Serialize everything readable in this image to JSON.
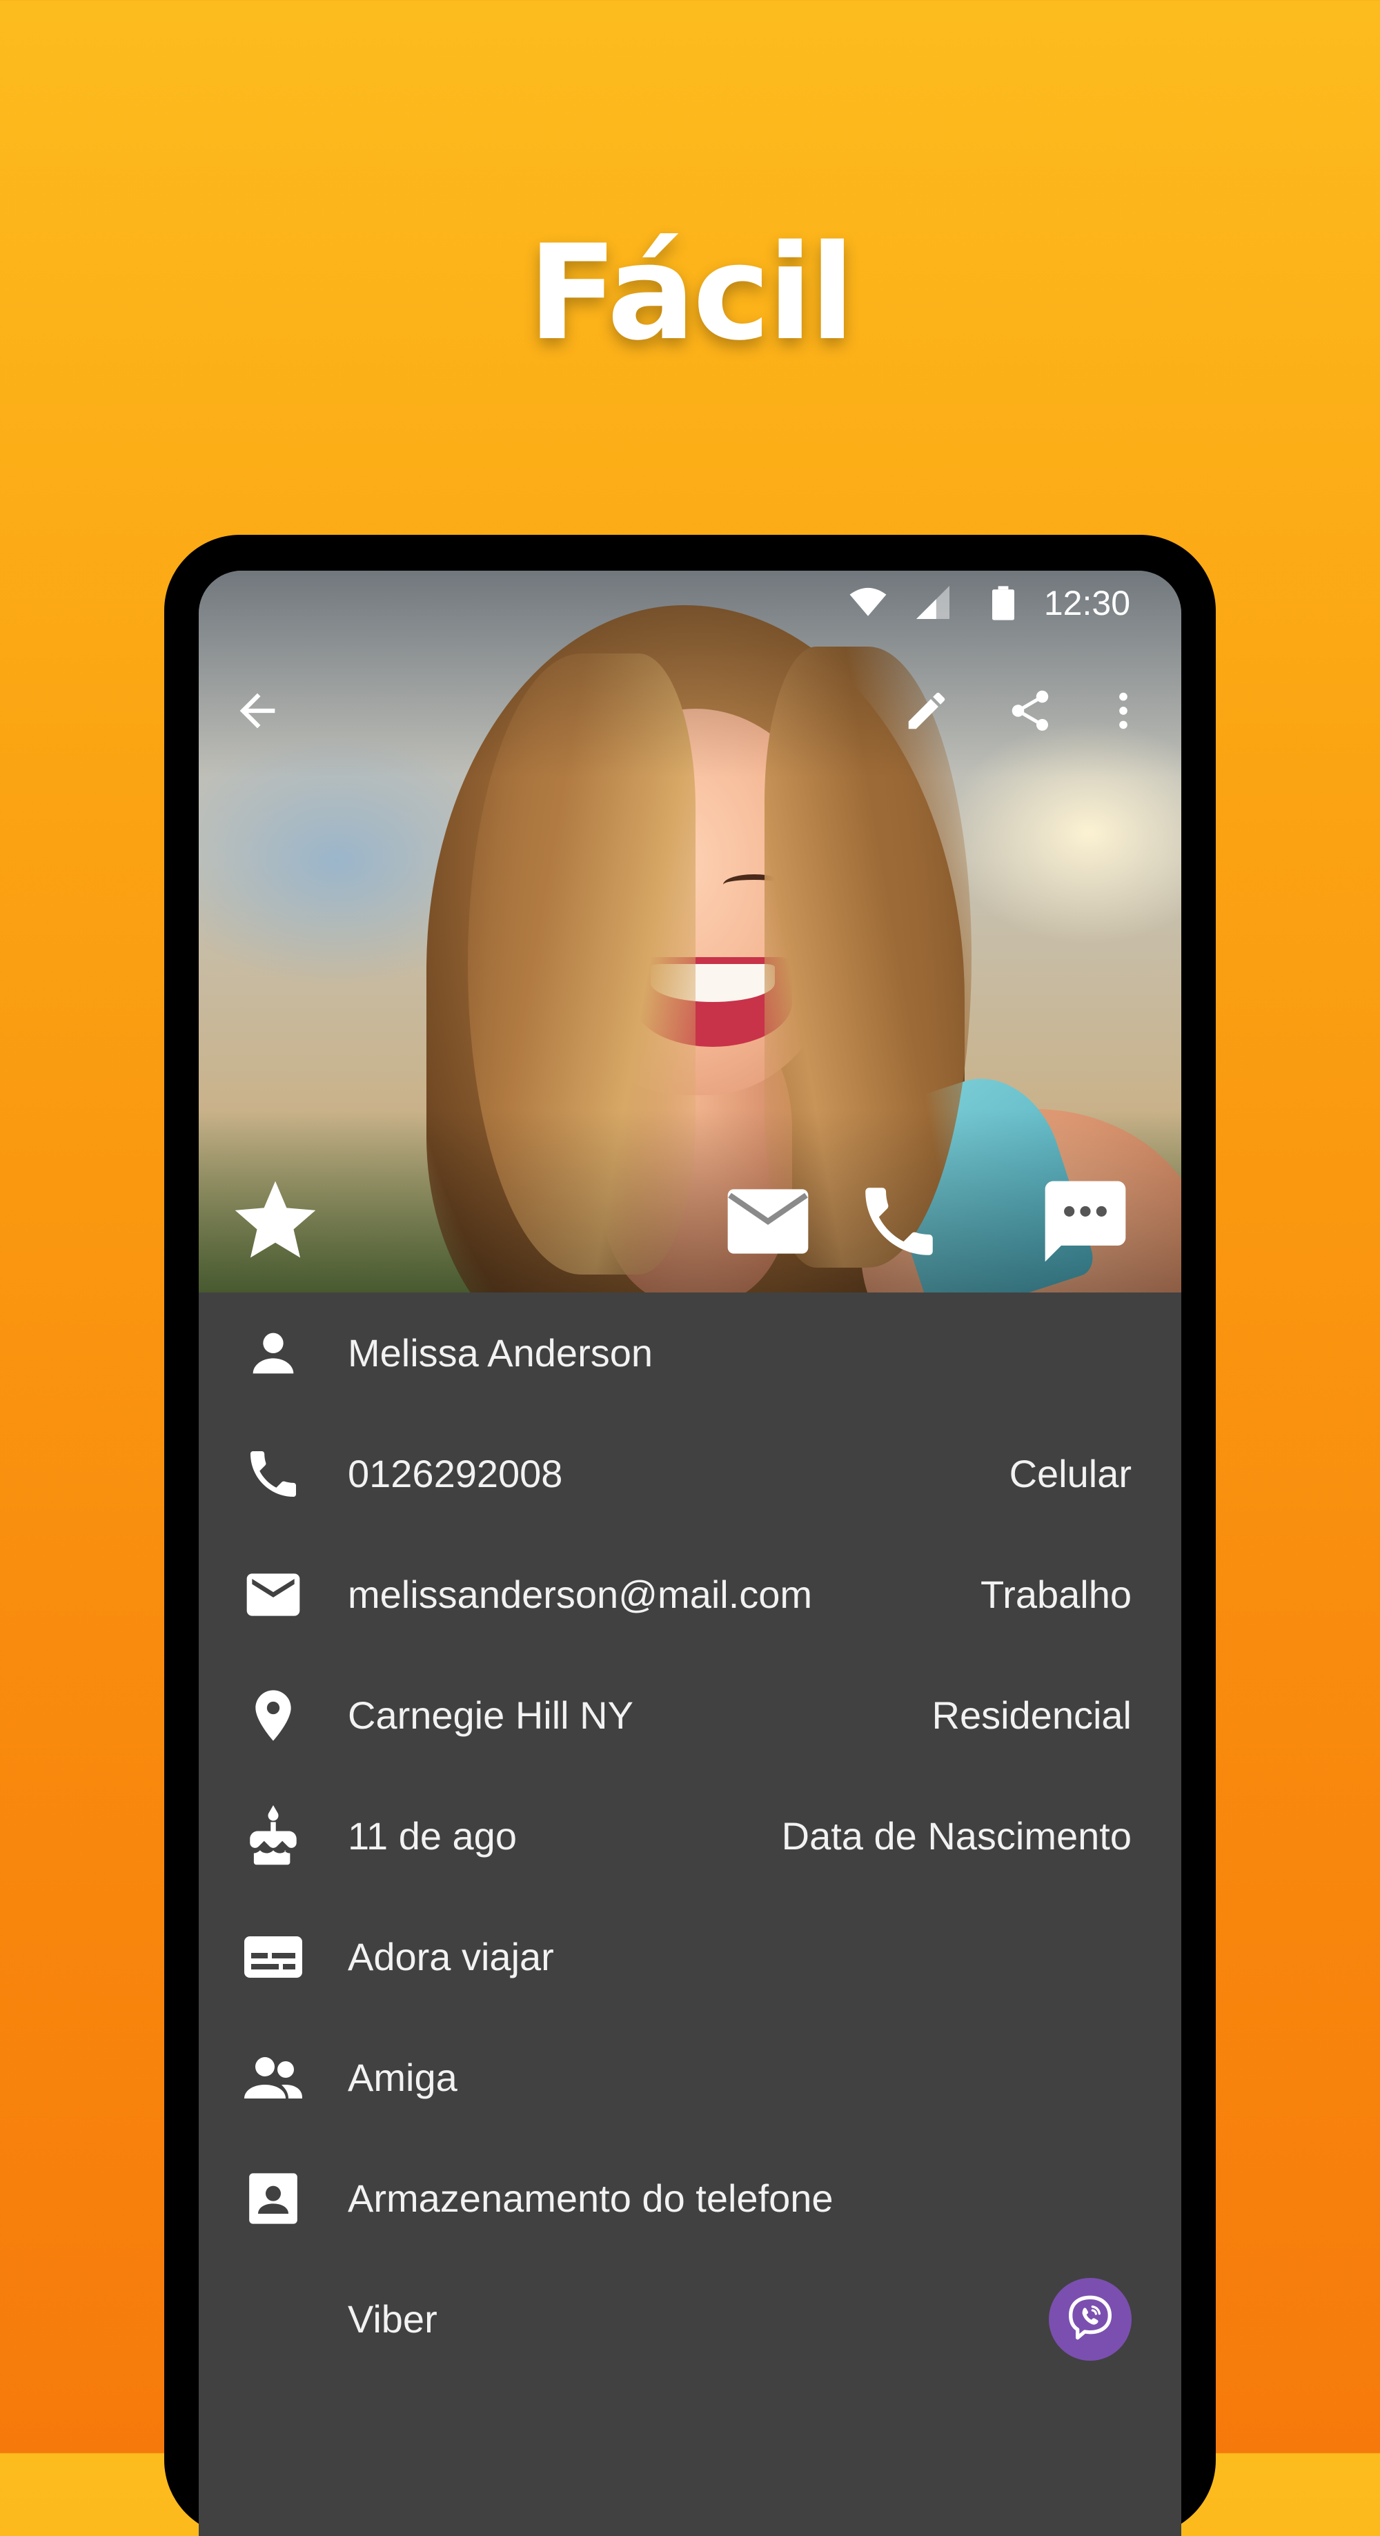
{
  "promo": {
    "title": "Fácil"
  },
  "status_bar": {
    "time": "12:30",
    "icons": [
      "wifi-icon",
      "cell-signal-icon",
      "battery-icon"
    ]
  },
  "toolbar": {
    "icons": [
      "back-arrow-icon",
      "edit-pencil-icon",
      "share-icon",
      "more-vert-icon"
    ]
  },
  "photo_actions": {
    "icons": [
      "star-icon",
      "email-icon",
      "phone-icon",
      "message-icon"
    ]
  },
  "contact": {
    "name": {
      "value": "Melissa Anderson",
      "icon": "person-icon"
    },
    "phone": {
      "value": "0126292008",
      "type": "Celular",
      "icon": "phone-icon"
    },
    "email": {
      "value": "melissanderson@mail.com",
      "type": "Trabalho",
      "icon": "email-icon"
    },
    "address": {
      "value": "Carnegie Hill NY",
      "type": "Residencial",
      "icon": "location-pin-icon"
    },
    "birthday": {
      "value": "11 de ago",
      "type": "Data de Nascimento",
      "icon": "cake-icon"
    },
    "notes": {
      "value": "Adora viajar",
      "icon": "notes-icon"
    },
    "group": {
      "value": "Amiga",
      "icon": "group-icon"
    },
    "source": {
      "value": "Armazenamento do telefone",
      "icon": "contact-card-icon"
    },
    "app": {
      "value": "Viber",
      "icon": "viber-icon",
      "badge_color": "#7b4fb0"
    }
  },
  "colors": {
    "background_top": "#FDBC1E",
    "background_bottom": "#F67A0B",
    "panel": "#414141",
    "text": "#f2f2f2"
  }
}
